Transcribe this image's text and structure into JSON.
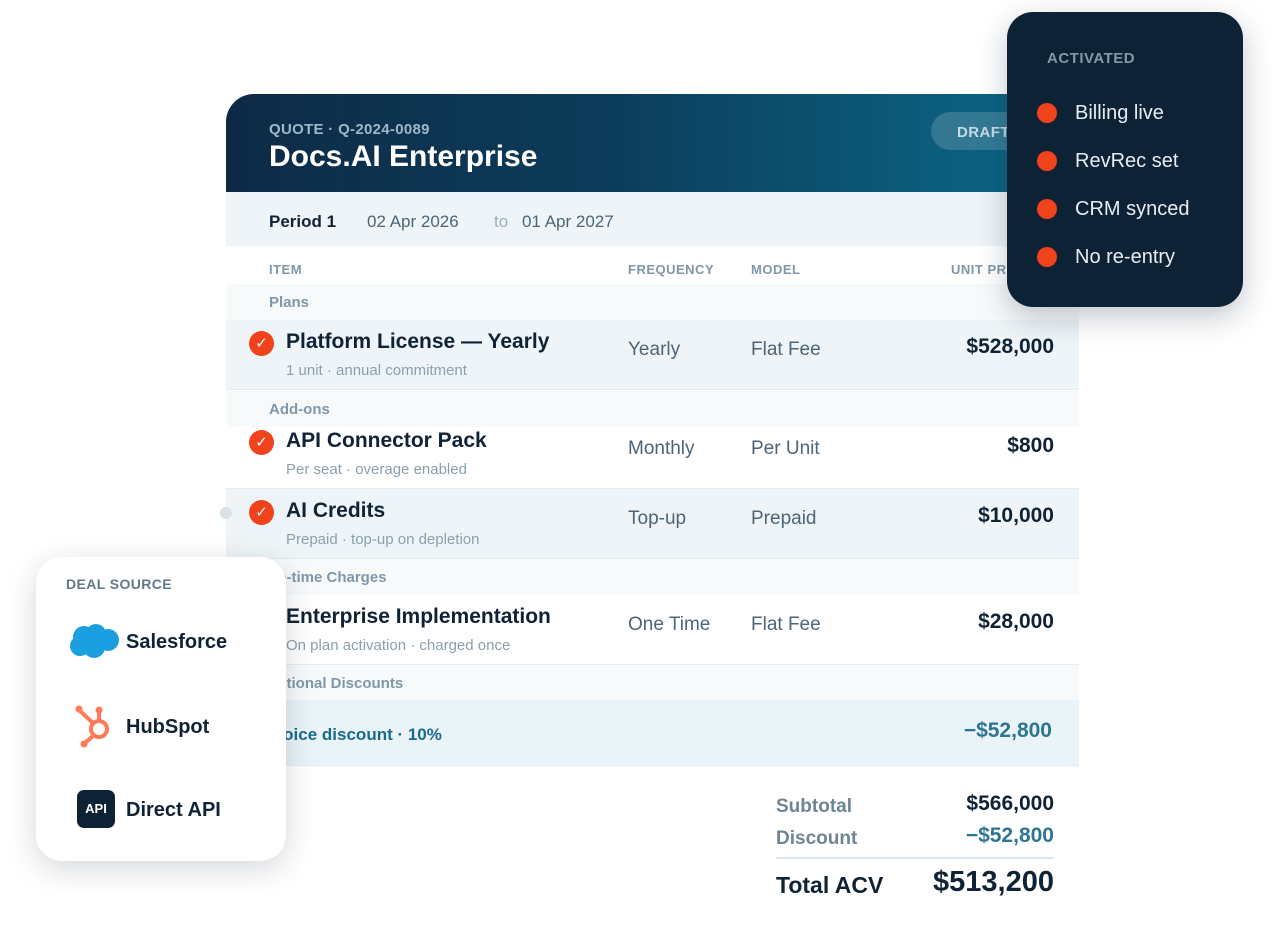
{
  "quote": {
    "id": "QUOTE · Q-2024-0089",
    "title": "Docs.AI Enterprise",
    "status": "DRAFT",
    "period": {
      "label": "Period 1",
      "start": "02 Apr 2026",
      "to": "to",
      "end": "01 Apr 2027"
    },
    "columns": {
      "item": "ITEM",
      "frequency": "FREQUENCY",
      "model": "MODEL",
      "unit_price": "UNIT PR"
    },
    "groups": {
      "plans": "Plans",
      "addons": "Add-ons",
      "onetime": "ne-time Charges",
      "discounts": "lditional Discounts"
    },
    "items": [
      {
        "name": "Platform License — Yearly",
        "sub": "1 unit · annual commitment",
        "frequency": "Yearly",
        "model": "Flat Fee",
        "price": "$528,000",
        "checked": true
      },
      {
        "name": "API Connector Pack",
        "sub": "Per seat · overage enabled",
        "frequency": "Monthly",
        "model": "Per Unit",
        "price": "$800",
        "checked": true
      },
      {
        "name": "AI Credits",
        "sub": "Prepaid · top-up on depletion",
        "frequency": "Top-up",
        "model": "Prepaid",
        "price": "$10,000",
        "checked": true
      },
      {
        "name": "Enterprise Implementation",
        "sub": "On plan activation · charged once",
        "frequency": "One Time",
        "model": "Flat Fee",
        "price": "$28,000",
        "checked": false
      }
    ],
    "discount": {
      "label": "ıvoice discount · 10%",
      "amount": "−$52,800"
    },
    "totals": {
      "subtotal_label": "Subtotal",
      "subtotal": "$566,000",
      "discount_label": "Discount",
      "discount": "−$52,800",
      "total_label": "Total ACV",
      "total": "$513,200"
    }
  },
  "activated": {
    "title": "ACTIVATED",
    "items": [
      "Billing live",
      "RevRec set",
      "CRM synced",
      "No re-entry"
    ],
    "dot_color": "#f0421b"
  },
  "deal_source": {
    "title": "DEAL SOURCE",
    "sources": [
      {
        "label": "Salesforce",
        "icon": "salesforce-cloud-icon"
      },
      {
        "label": "HubSpot",
        "icon": "hubspot-sprocket-icon"
      },
      {
        "label": "Direct API",
        "icon": "api-icon",
        "icon_text": "API"
      }
    ]
  },
  "colors": {
    "accent": "#f0421b",
    "header_dark": "#0d2a45",
    "header_light": "#0c6a8a",
    "panel_dark": "#0e2236",
    "salesforce": "#1aa0e0",
    "hubspot": "#ff7a59"
  }
}
